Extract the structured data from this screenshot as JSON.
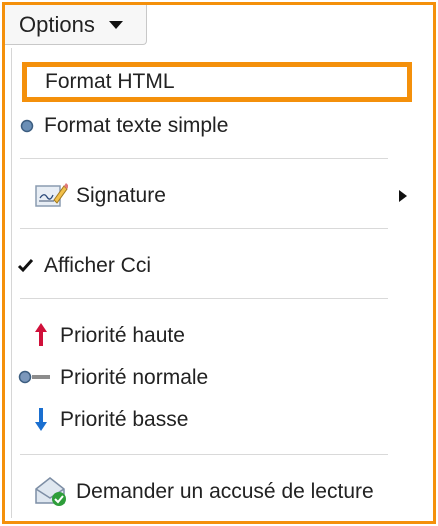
{
  "toolbar": {
    "options_label": "Options"
  },
  "menu": {
    "format_html": "Format HTML",
    "format_text": "Format texte simple",
    "signature": "Signature",
    "show_bcc": "Afficher Cci",
    "priority_high": "Priorité haute",
    "priority_normal": "Priorité normale",
    "priority_low": "Priorité basse",
    "read_receipt": "Demander un accusé de lecture"
  },
  "colors": {
    "highlight": "#f4900b",
    "priority_high": "#d0103a",
    "priority_low": "#1a6fd0"
  },
  "icons": {
    "format_text": "radio-dot-icon",
    "signature": "signature-pen-icon",
    "show_bcc": "checkmark-icon",
    "priority_high": "arrow-up-icon",
    "priority_normal": "priority-normal-icon",
    "priority_low": "arrow-down-icon",
    "read_receipt": "envelope-check-icon"
  }
}
